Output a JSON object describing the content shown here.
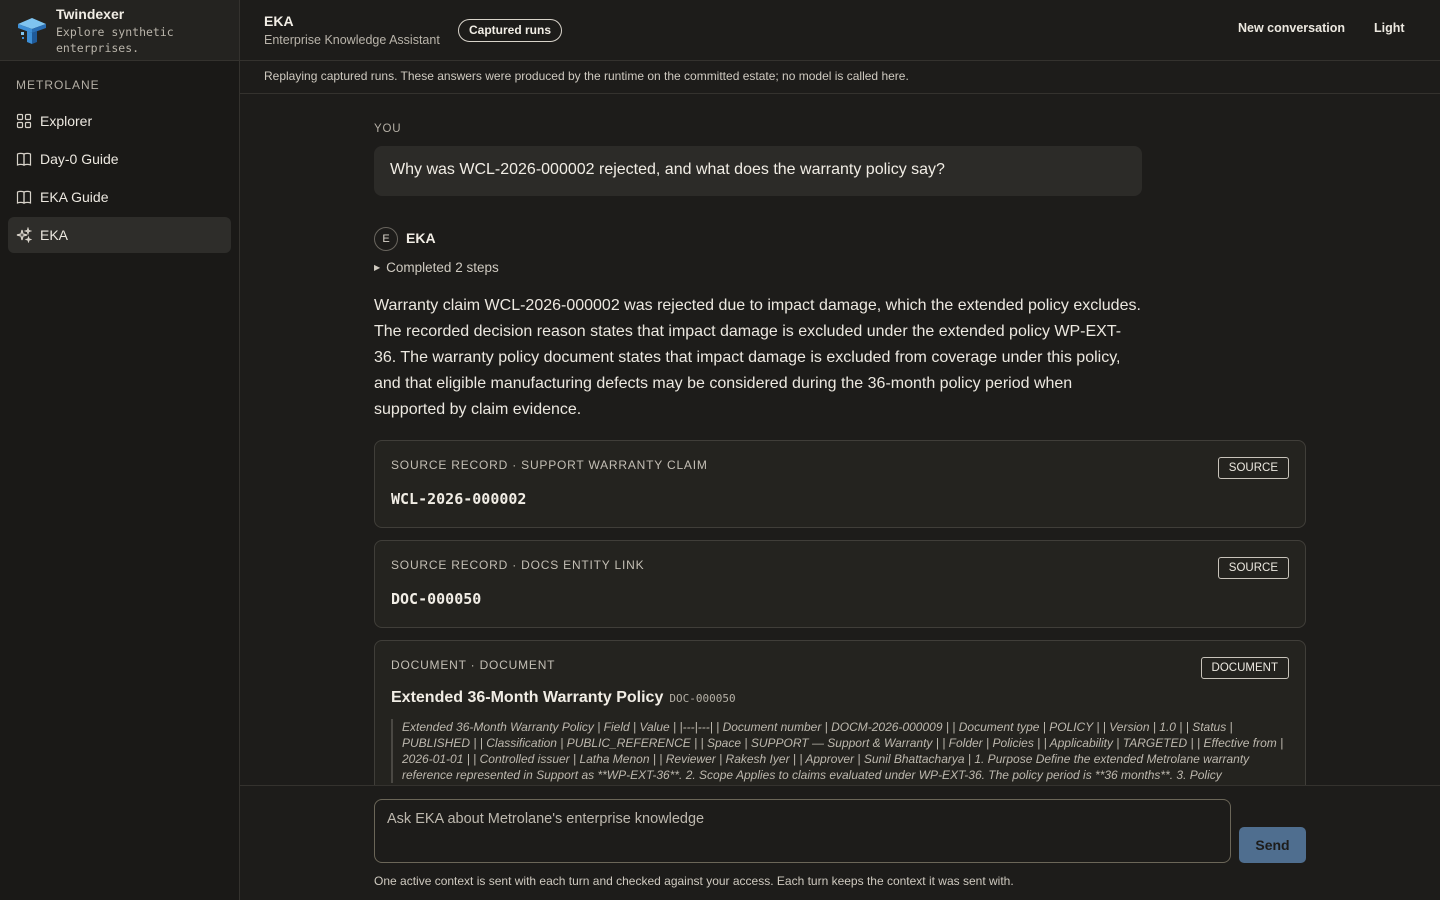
{
  "sidebar": {
    "brand_name": "Twindexer",
    "brand_tagline": "Explore synthetic enterprises.",
    "org_label": "METROLANE",
    "items": [
      {
        "label": "Explorer",
        "icon": "grid-icon"
      },
      {
        "label": "Day-0 Guide",
        "icon": "book-icon"
      },
      {
        "label": "EKA Guide",
        "icon": "book-icon"
      },
      {
        "label": "EKA",
        "icon": "sparkle-icon",
        "active": true
      }
    ]
  },
  "header": {
    "title": "EKA",
    "subtitle": "Enterprise Knowledge Assistant",
    "badge": "Captured runs",
    "new_conversation": "New conversation",
    "theme_toggle": "Light"
  },
  "notice": "Replaying captured runs. These answers were produced by the runtime on the committed estate; no model is called here.",
  "conversation": {
    "you_label": "YOU",
    "question": "Why was WCL-2026-000002 rejected, and what does the warranty policy say?",
    "assistant_avatar": "E",
    "assistant_name": "EKA",
    "steps_label": "Completed 2 steps",
    "answer": "Warranty claim WCL-2026-000002 was rejected due to impact damage, which the extended policy excludes. The recorded decision reason states that impact damage is excluded under the extended policy WP-EXT-36. The warranty policy document states that impact damage is excluded from coverage under this policy, and that eligible manufacturing defects may be considered during the 36-month policy period when supported by claim evidence.",
    "cards": [
      {
        "kicker": "SOURCE RECORD · SUPPORT WARRANTY CLAIM",
        "id": "WCL-2026-000002",
        "tag": "SOURCE"
      },
      {
        "kicker": "SOURCE RECORD · DOCS ENTITY LINK",
        "id": "DOC-000050",
        "tag": "SOURCE"
      },
      {
        "kicker": "DOCUMENT · DOCUMENT",
        "title": "Extended 36-Month Warranty Policy",
        "code": "DOC-000050",
        "tag": "DOCUMENT",
        "excerpt": "Extended 36-Month Warranty Policy | Field | Value | |---|---| | Document number | DOCM-2026-000009 | | Document type | POLICY | | Version | 1.0 | | Status | PUBLISHED | | Classification | PUBLIC_REFERENCE | | Space | SUPPORT — Support & Warranty | | Folder | Policies | | Applicability | TARGETED | | Effective from | 2026-01-01 | | Controlled issuer | Latha Menon | | Reviewer | Rakesh Iyer | | Approver | Sunil Bhattacharya | 1. Purpose Define the extended Metrolane warranty reference represented in Support as **WP-EXT-36**. 2. Scope Applies to claims evaluated under WP-EXT-36. The policy period is **36 months**. 3. Policy"
      }
    ]
  },
  "composer": {
    "placeholder": "Ask EKA about Metrolane's enterprise knowledge",
    "send_label": "Send",
    "note": "One active context is sent with each turn and checked against your access. Each turn keeps the context it was sent with."
  }
}
